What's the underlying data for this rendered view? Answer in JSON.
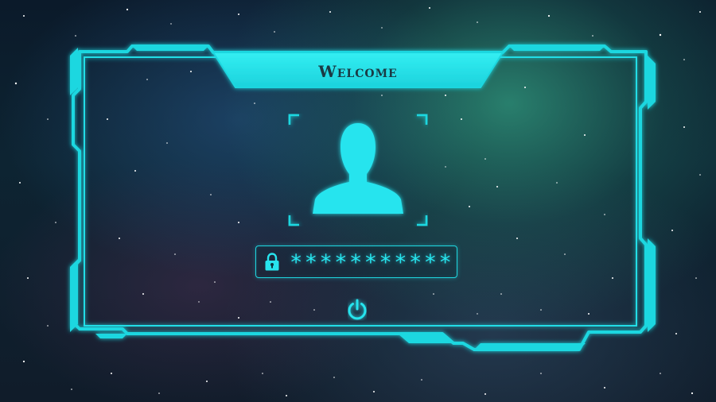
{
  "login": {
    "title": "Welcome",
    "password_mask": "***********"
  },
  "icons": {
    "avatar": "user-silhouette-icon",
    "lock": "padlock-icon",
    "power": "power-icon"
  },
  "colors": {
    "accent": "#1fd7e0",
    "accent_bright": "#27e4ee",
    "title_text": "#1a3a44"
  }
}
